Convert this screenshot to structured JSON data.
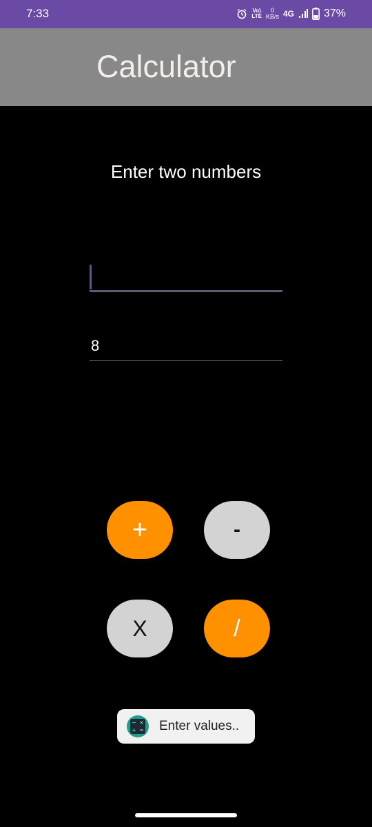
{
  "status_bar": {
    "time": "7:33",
    "volte_top": "Vo)",
    "volte_bottom": "LTE",
    "net_speed_value": "0",
    "net_speed_unit": "KB/s",
    "network_type": "4G",
    "battery_percent": "37%",
    "icons": [
      "alarm-icon",
      "signal-icon",
      "battery-icon"
    ],
    "background_color": "#6a4aa4"
  },
  "app_bar": {
    "title": "Calculator",
    "background_color": "#888888"
  },
  "main": {
    "prompt": "Enter two numbers",
    "first_input": {
      "value": "",
      "placeholder": ""
    },
    "second_input": {
      "value": "8",
      "placeholder": ""
    }
  },
  "buttons": {
    "add_label": "+",
    "subtract_label": "-",
    "multiply_label": "X",
    "divide_label": "/",
    "accent_color": "#ff9100",
    "secondary_color": "#d3d3d3"
  },
  "toast": {
    "icon": "calculator-app-icon",
    "message": "Enter values.."
  }
}
